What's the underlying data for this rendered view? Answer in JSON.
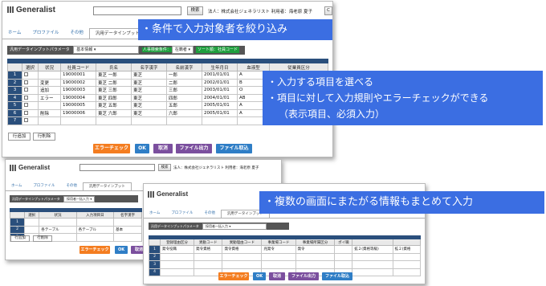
{
  "app": {
    "logo": "Generalist",
    "search": "検索",
    "corp": "法人：株式会社ジェネラリスト",
    "user": "利用者：海老原 夏子",
    "dot": "C"
  },
  "tabs": [
    "ホーム",
    "プロファイル",
    "その他",
    "汎用データインプット"
  ],
  "win1": {
    "param_label": "汎用データインプットパラメータ",
    "param_value": "基本情報",
    "cond_label": "人事検索条件：",
    "cond_value": "在籍者",
    "sort_label": "ソート順：社員コード",
    "columns": [
      "選択",
      "状況",
      "社員コード",
      "氏名",
      "名字漢字",
      "名前漢字",
      "生年月日",
      "血液型",
      "従業員区分"
    ],
    "rows": [
      {
        "n": "1",
        "status": "",
        "code": "19000001",
        "name": "東芝 一郎",
        "sei": "東芝",
        "mei": "一郎",
        "dob": "2001/01/01",
        "blood": "A"
      },
      {
        "n": "2",
        "status": "変更",
        "code": "19000002",
        "name": "東芝 二郎",
        "sei": "東芝",
        "mei": "二郎",
        "dob": "2002/01/01",
        "blood": "B"
      },
      {
        "n": "3",
        "status": "追加",
        "code": "19000003",
        "name": "東芝 三郎",
        "sei": "東芝",
        "mei": "三郎",
        "dob": "2003/01/01",
        "blood": "O"
      },
      {
        "n": "4",
        "status": "エラー",
        "code": "19000004",
        "name": "東芝 四郎",
        "sei": "東芝",
        "mei": "四郎",
        "dob": "2004/01/01",
        "blood": "AB"
      },
      {
        "n": "5",
        "status": "",
        "code": "19000005",
        "name": "東芝 五郎",
        "sei": "東芝",
        "mei": "五郎",
        "dob": "2005/01/01",
        "blood": "A"
      },
      {
        "n": "6",
        "status": "削除",
        "code": "19000006",
        "name": "東芝 六郎",
        "sei": "東芝",
        "mei": "六郎",
        "dob": "2005/01/01",
        "blood": "A"
      },
      {
        "n": "7",
        "status": "",
        "code": "",
        "name": "",
        "sei": "",
        "mei": "",
        "dob": "",
        "blood": ""
      }
    ]
  },
  "buttons": {
    "add_row": "行追加",
    "del_row": "行削除",
    "error_check": "エラーチェック",
    "ok": "OK",
    "cancel": "取消",
    "file_out": "ファイル出力",
    "file_in": "ファイル取込"
  },
  "win2": {
    "param_label": "汎用データインプットパラメータ",
    "param_value": "採用者一括入力",
    "columns": [
      "",
      "選択",
      "状況",
      "入力項目日",
      "名字漢字"
    ],
    "rows": [
      {
        "n": "1",
        "a": "",
        "b": "",
        "c": "",
        "d": ""
      },
      {
        "n": "2",
        "a": "",
        "b": "各テーブル",
        "c": "各テーブル",
        "d": "基本"
      },
      {
        "n": "3",
        "a": "",
        "b": "",
        "c": "",
        "d": ""
      }
    ]
  },
  "win3": {
    "param_label": "汎用データインプットパラメータ",
    "param_value": "採用者一括入力",
    "columns": [
      "登録理由区分",
      "異動コード",
      "異動理由コード",
      "事業場コード",
      "事業場所属区分",
      "ポイ職",
      "",
      ""
    ],
    "rows": [
      {
        "n": "1",
        "c": [
          "発令役職",
          "発令資格",
          "発令資格",
          "兆発令",
          "発令",
          "",
          "拡２(資格等級)",
          "拡２(資格"
        ]
      },
      {
        "n": "2",
        "c": [
          "",
          "",
          "",
          "",
          "",
          "",
          "",
          ""
        ]
      },
      {
        "n": "3",
        "c": [
          "",
          "",
          "",
          "",
          "",
          "",
          "",
          ""
        ]
      },
      {
        "n": "4",
        "c": [
          "",
          "",
          "",
          "",
          "",
          "",
          "",
          ""
        ]
      }
    ]
  },
  "callouts": {
    "c1": "・条件で入力対象者を絞り込み",
    "c2a": "・入力する項目を選べる",
    "c2b": "・項目に対して入力規則やエラーチェックができる",
    "c2c": "（表示項目、必須入力）",
    "c3": "・複数の画面にまたがる情報もまとめて入力"
  },
  "colors": {
    "callout": "#3b6ee2",
    "header": "#2a4f7c",
    "error_check": "#f47d20",
    "ok": "#2f7ec6",
    "cancel": "#7b4f9e",
    "file_out": "#7b4f9e",
    "file_in": "#2f7ec6",
    "sort_tag": "#1e9e3d"
  }
}
